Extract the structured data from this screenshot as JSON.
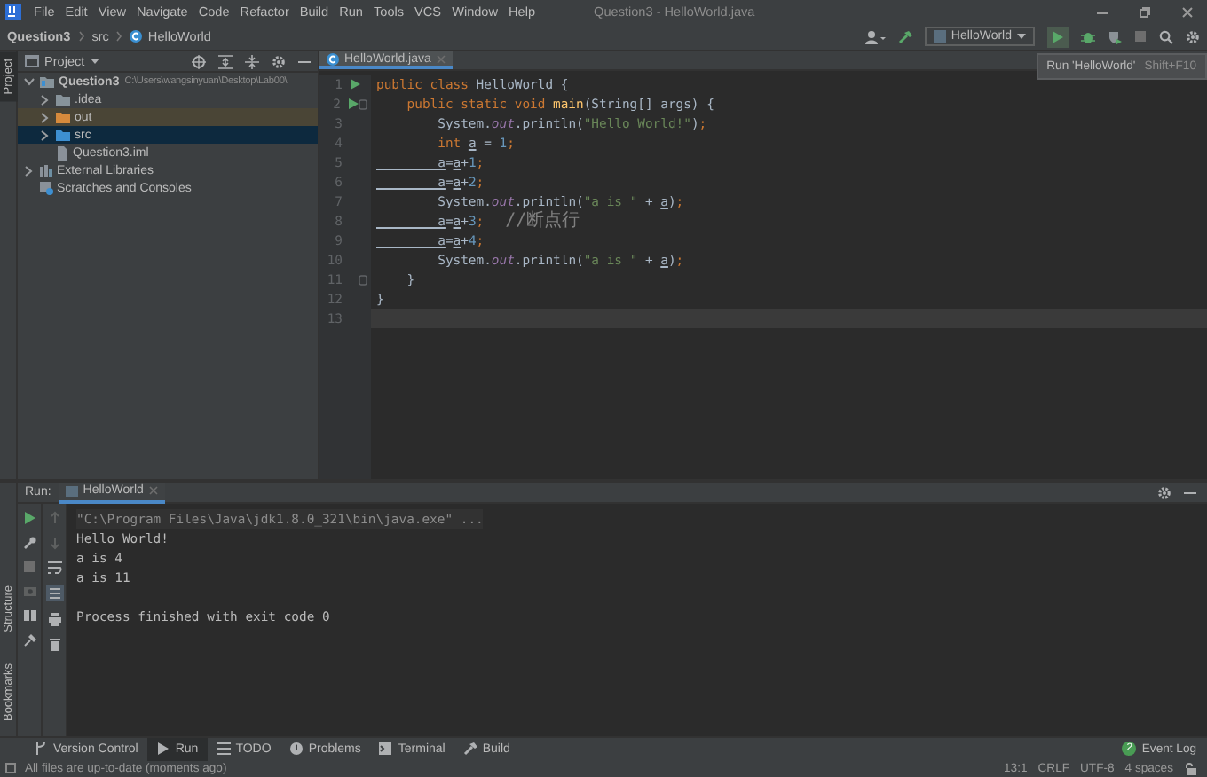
{
  "window": {
    "title": "Question3 - HelloWorld.java"
  },
  "menu": [
    "File",
    "Edit",
    "View",
    "Navigate",
    "Code",
    "Refactor",
    "Build",
    "Run",
    "Tools",
    "VCS",
    "Window",
    "Help"
  ],
  "breadcrumb": [
    "Question3",
    "src",
    "HelloWorld"
  ],
  "run_config": {
    "label": "HelloWorld"
  },
  "tooltip": {
    "label": "Run 'HelloWorld'",
    "shortcut": "Shift+F10"
  },
  "left_stripe_top": [
    {
      "label": "Project",
      "selected": true
    }
  ],
  "left_stripe_bottom": [
    {
      "label": "Structure",
      "selected": false
    },
    {
      "label": "Bookmarks",
      "selected": false
    }
  ],
  "project_panel": {
    "title": "Project",
    "tree": [
      {
        "label": "Question3",
        "kind": "module",
        "path": "C:\\Users\\wangsinyuan\\Desktop\\Lab00\\",
        "expanded": true,
        "selected": false,
        "children": [
          {
            "label": ".idea",
            "kind": "folder",
            "expanded": false,
            "selected": false
          },
          {
            "label": "out",
            "kind": "excluded",
            "expanded": false,
            "selected": false
          },
          {
            "label": "src",
            "kind": "source",
            "expanded": false,
            "selected": true
          },
          {
            "label": "Question3.iml",
            "kind": "file",
            "selected": false
          }
        ]
      },
      {
        "label": "External Libraries",
        "kind": "library",
        "expanded": false,
        "selected": false
      },
      {
        "label": "Scratches and Consoles",
        "kind": "scratch",
        "selected": false
      }
    ]
  },
  "editor": {
    "tabs": [
      {
        "label": "HelloWorld.java",
        "selected": true
      }
    ],
    "lines": [
      {
        "number": "1",
        "run_marker": true,
        "fold": false,
        "selected": false,
        "tokens": [
          {
            "kind": "kw",
            "text": "public class "
          },
          {
            "kind": "plain",
            "text": "HelloWorld {"
          }
        ]
      },
      {
        "number": "2",
        "run_marker": true,
        "fold": true,
        "selected": false,
        "tokens": [
          {
            "kind": "kw",
            "text": "    public static void "
          },
          {
            "kind": "fn",
            "text": "main"
          },
          {
            "kind": "plain",
            "text": "(String[] args) {"
          }
        ]
      },
      {
        "number": "3",
        "run_marker": false,
        "fold": false,
        "selected": false,
        "tokens": [
          {
            "kind": "plain",
            "text": "        System."
          },
          {
            "kind": "field",
            "text": "out"
          },
          {
            "kind": "plain",
            "text": ".println("
          },
          {
            "kind": "str",
            "text": "\"Hello World!\""
          },
          {
            "kind": "plain",
            "text": ")"
          },
          {
            "kind": "punct",
            "text": ";"
          }
        ]
      },
      {
        "number": "4",
        "run_marker": false,
        "fold": false,
        "selected": false,
        "tokens": [
          {
            "kind": "kw",
            "text": "        int "
          },
          {
            "kind": "var",
            "text": "a"
          },
          {
            "kind": "plain",
            "text": " = "
          },
          {
            "kind": "num",
            "text": "1"
          },
          {
            "kind": "punct",
            "text": ";"
          }
        ]
      },
      {
        "number": "5",
        "run_marker": false,
        "fold": false,
        "selected": false,
        "tokens": [
          {
            "kind": "var",
            "text": "        a"
          },
          {
            "kind": "plain",
            "text": "="
          },
          {
            "kind": "var",
            "text": "a"
          },
          {
            "kind": "plain",
            "text": "+"
          },
          {
            "kind": "num",
            "text": "1"
          },
          {
            "kind": "punct",
            "text": ";"
          }
        ]
      },
      {
        "number": "6",
        "run_marker": false,
        "fold": false,
        "selected": false,
        "tokens": [
          {
            "kind": "var",
            "text": "        a"
          },
          {
            "kind": "plain",
            "text": "="
          },
          {
            "kind": "var",
            "text": "a"
          },
          {
            "kind": "plain",
            "text": "+"
          },
          {
            "kind": "num",
            "text": "2"
          },
          {
            "kind": "punct",
            "text": ";"
          }
        ]
      },
      {
        "number": "7",
        "run_marker": false,
        "fold": false,
        "selected": false,
        "tokens": [
          {
            "kind": "plain",
            "text": "        System."
          },
          {
            "kind": "field",
            "text": "out"
          },
          {
            "kind": "plain",
            "text": ".println("
          },
          {
            "kind": "str",
            "text": "\"a is \""
          },
          {
            "kind": "plain",
            "text": " + "
          },
          {
            "kind": "var",
            "text": "a"
          },
          {
            "kind": "plain",
            "text": ")"
          },
          {
            "kind": "punct",
            "text": ";"
          }
        ]
      },
      {
        "number": "8",
        "run_marker": false,
        "fold": false,
        "selected": false,
        "tokens": [
          {
            "kind": "var",
            "text": "        a"
          },
          {
            "kind": "plain",
            "text": "="
          },
          {
            "kind": "var",
            "text": "a"
          },
          {
            "kind": "plain",
            "text": "+"
          },
          {
            "kind": "num",
            "text": "3"
          },
          {
            "kind": "punct",
            "text": ";"
          },
          {
            "kind": "cmt",
            "text": "  //断点行"
          }
        ]
      },
      {
        "number": "9",
        "run_marker": false,
        "fold": false,
        "selected": false,
        "tokens": [
          {
            "kind": "var",
            "text": "        a"
          },
          {
            "kind": "plain",
            "text": "="
          },
          {
            "kind": "var",
            "text": "a"
          },
          {
            "kind": "plain",
            "text": "+"
          },
          {
            "kind": "num",
            "text": "4"
          },
          {
            "kind": "punct",
            "text": ";"
          }
        ]
      },
      {
        "number": "10",
        "run_marker": false,
        "fold": false,
        "selected": false,
        "tokens": [
          {
            "kind": "plain",
            "text": "        System."
          },
          {
            "kind": "field",
            "text": "out"
          },
          {
            "kind": "plain",
            "text": ".println("
          },
          {
            "kind": "str",
            "text": "\"a is \""
          },
          {
            "kind": "plain",
            "text": " + "
          },
          {
            "kind": "var",
            "text": "a"
          },
          {
            "kind": "plain",
            "text": ")"
          },
          {
            "kind": "punct",
            "text": ";"
          }
        ]
      },
      {
        "number": "11",
        "run_marker": false,
        "fold": true,
        "selected": false,
        "tokens": [
          {
            "kind": "plain",
            "text": "    }"
          }
        ]
      },
      {
        "number": "12",
        "run_marker": false,
        "fold": false,
        "selected": false,
        "tokens": [
          {
            "kind": "plain",
            "text": "}"
          }
        ]
      },
      {
        "number": "13",
        "run_marker": false,
        "fold": false,
        "selected": true
      }
    ]
  },
  "run_panel": {
    "label": "Run:",
    "tabs": [
      {
        "label": "HelloWorld",
        "selected": true
      }
    ],
    "console": [
      {
        "kind": "command",
        "text": "\"C:\\Program Files\\Java\\jdk1.8.0_321\\bin\\java.exe\" ..."
      },
      {
        "kind": "output",
        "text": "Hello World!"
      },
      {
        "kind": "output",
        "text": "a is 4"
      },
      {
        "kind": "output",
        "text": "a is 11"
      },
      {
        "kind": "exit",
        "text": "Process finished with exit code 0"
      }
    ]
  },
  "tool_tabs": [
    {
      "label": "Version Control",
      "kind": "vcs",
      "selected": false
    },
    {
      "label": "Run",
      "kind": "run",
      "selected": true
    },
    {
      "label": "TODO",
      "kind": "todo",
      "selected": false
    },
    {
      "label": "Problems",
      "kind": "problems",
      "selected": false
    },
    {
      "label": "Terminal",
      "kind": "terminal",
      "selected": false
    },
    {
      "label": "Build",
      "kind": "build",
      "selected": false
    }
  ],
  "event_log": {
    "count": "2",
    "label": "Event Log"
  },
  "status_bar": {
    "message": "All files are up-to-date (moments ago)",
    "items": [
      "13:1",
      "CRLF",
      "UTF-8",
      "4 spaces"
    ]
  }
}
